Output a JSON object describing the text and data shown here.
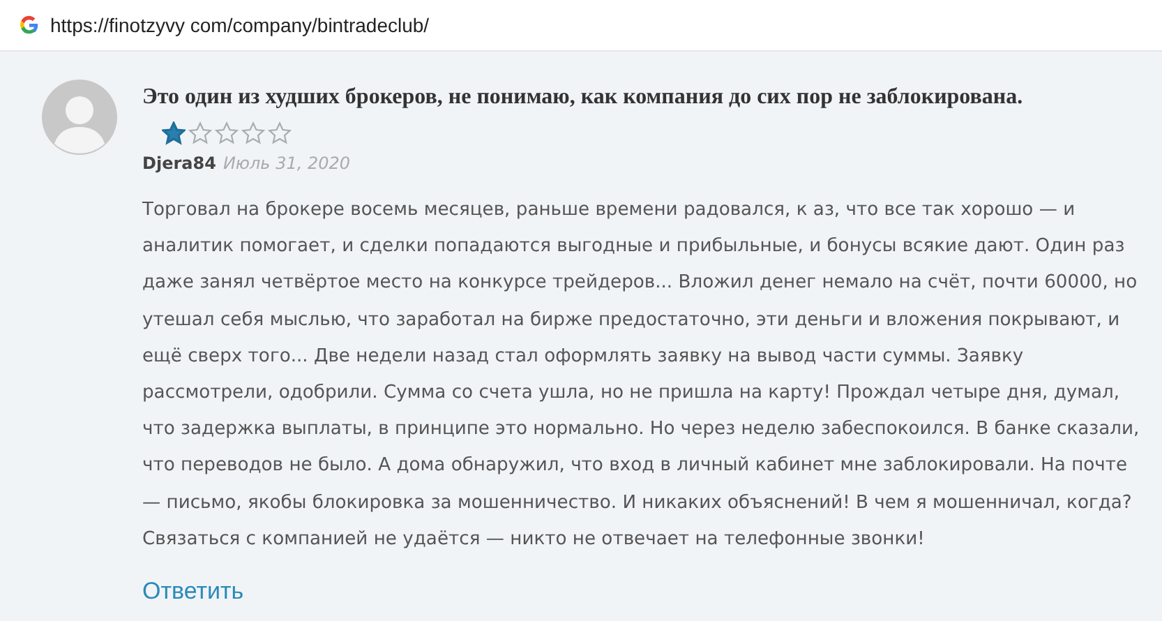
{
  "address_bar": {
    "url": "https://finotzyvy com/company/bintradeclub/"
  },
  "review": {
    "title": "Это один из худших брокеров, не понимаю, как компания до сих пор не заблокирована.",
    "stars": 1,
    "author": "Djera84",
    "date": "Июль 31, 2020",
    "body": "Торговал на брокере восемь месяцев, раньше времени радовался, к аз, что все так хорошо — и аналитик помогает, и сделки попадаются выгодные и прибыльные, и бонусы всякие дают. Один раз даже занял четвёртое место на конкурсе трейдеров... Вложил денег немало на счёт, почти 60000, но утешал себя мыслью, что заработал на бирже предостаточно, эти деньги и вложения покрывают, и ещё сверх того... Две недели назад стал оформлять заявку на вывод части суммы. Заявку рассмотрели, одобрили. Сумма со счета ушла, но не пришла на карту! Прождал четыре дня, думал, что задержка выплаты, в принципе это нормально. Но через неделю забеспокоился. В банке сказали, что переводов не было. А дома обнаружил, что вход в личный кабинет мне заблокировали. На почте — письмо, якобы блокировка за мошенничество. И никаких объяснений! В чем я мошенничал, когда? Связаться с компанией не удаётся — никто не отвечает на телефонные звонки!",
    "reply_link": "Ответить"
  }
}
